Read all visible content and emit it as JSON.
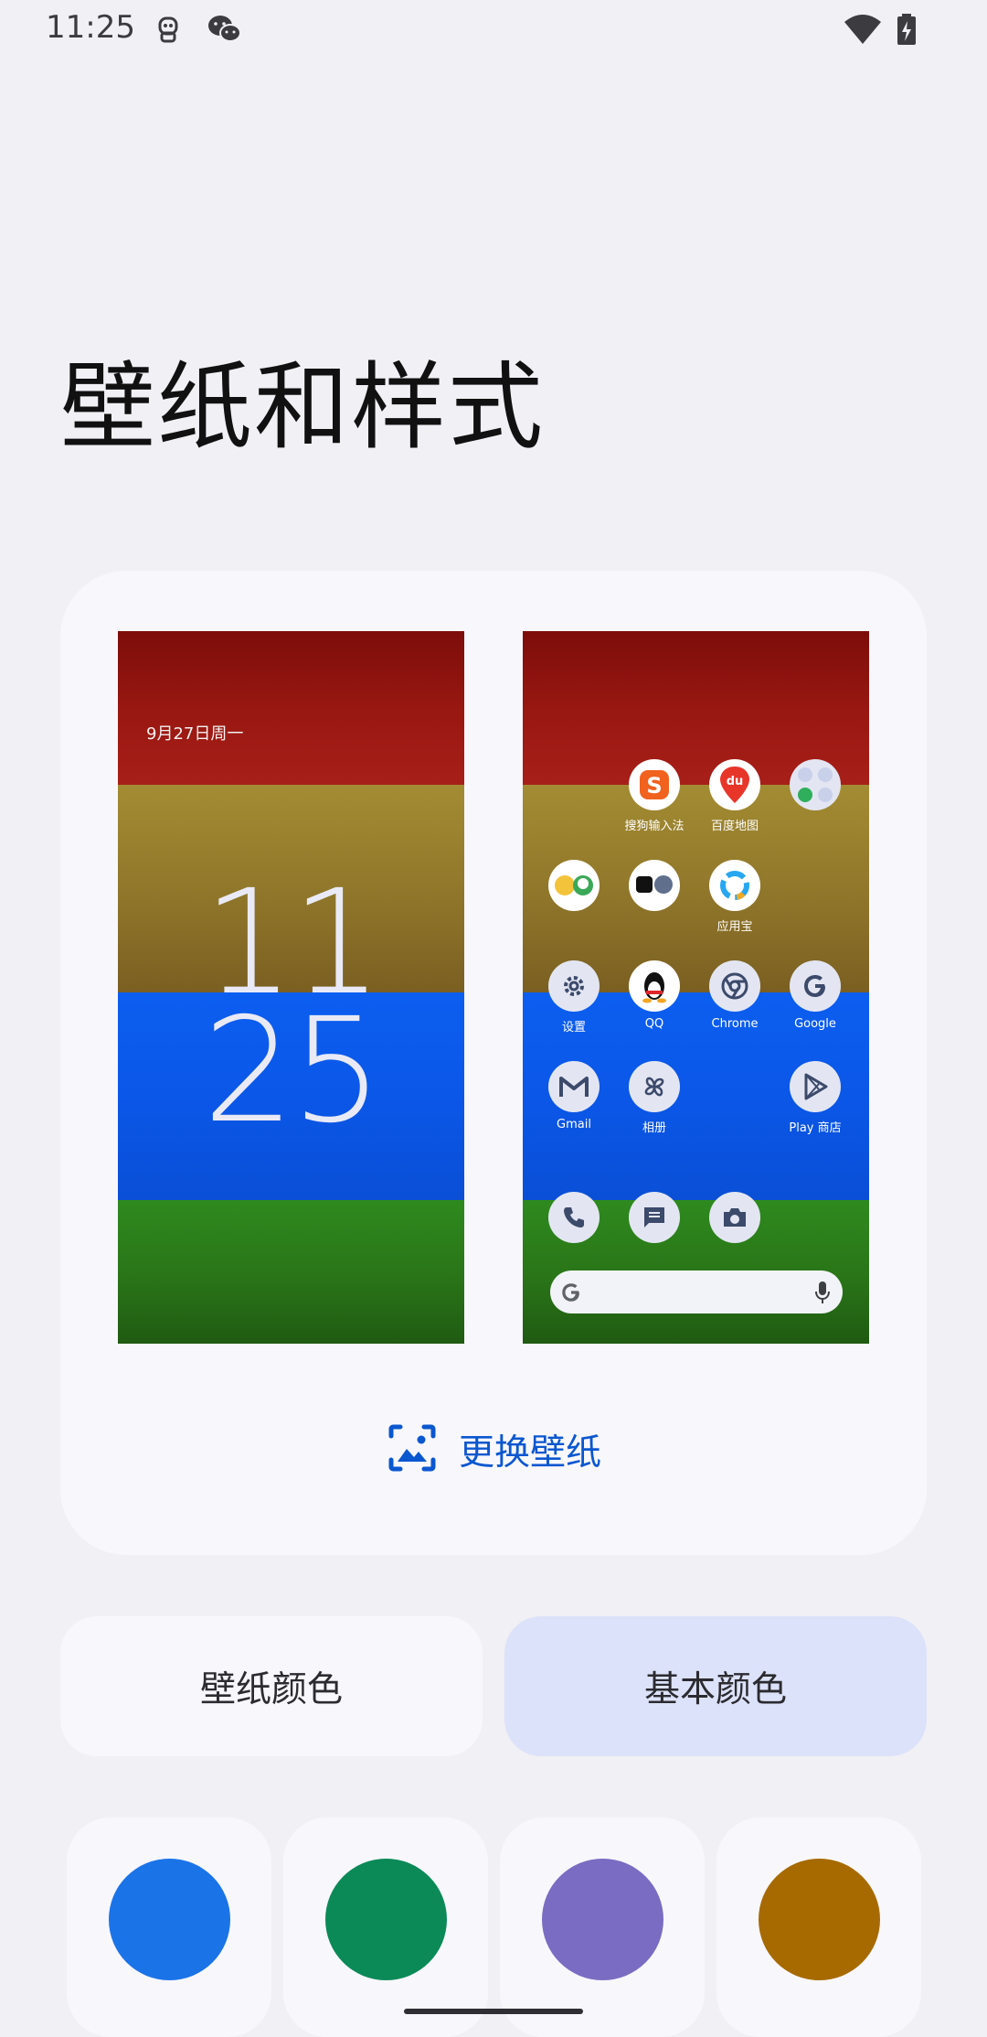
{
  "status_bar": {
    "time": "11:25",
    "icons": [
      "robot-notification-icon",
      "wechat-icon",
      "wifi-icon",
      "battery-charging-icon"
    ]
  },
  "title": "壁纸和样式",
  "preview": {
    "lock_screen": {
      "date": "9月27日周一",
      "hour": "11",
      "minute": "25"
    },
    "home_screen": {
      "apps": [
        {
          "label": "搜狗输入法",
          "icon": "sogou-input-icon"
        },
        {
          "label": "百度地图",
          "icon": "baidu-maps-icon"
        },
        {
          "label": "",
          "icon": "app-folder-icon"
        },
        {
          "label": "",
          "icon": "game-folder-icon"
        },
        {
          "label": "",
          "icon": "media-folder-icon"
        },
        {
          "label": "应用宝",
          "icon": "yingyongbao-icon"
        },
        {
          "label": "设置",
          "icon": "settings-gear-icon"
        },
        {
          "label": "QQ",
          "icon": "qq-penguin-icon"
        },
        {
          "label": "Chrome",
          "icon": "chrome-icon"
        },
        {
          "label": "Google",
          "icon": "google-g-icon"
        },
        {
          "label": "Gmail",
          "icon": "gmail-icon"
        },
        {
          "label": "相册",
          "icon": "photos-pinwheel-icon"
        },
        {
          "label": "Play 商店",
          "icon": "play-store-icon"
        }
      ],
      "dock": [
        "phone-icon",
        "messages-icon",
        "camera-icon"
      ],
      "search_bar": {
        "left_icon": "google-g-icon",
        "right_icon": "mic-icon"
      }
    }
  },
  "change_wallpaper": {
    "label": "更换壁纸",
    "icon": "change-wallpaper-icon"
  },
  "tabs": [
    {
      "label": "壁纸颜色",
      "selected": false
    },
    {
      "label": "基本颜色",
      "selected": true
    }
  ],
  "color_swatches": [
    "#1b73e8",
    "#0b8a58",
    "#7a6cc2",
    "#a76a00"
  ],
  "colors": {
    "accent": "#0b57d0",
    "selected_tab_bg": "#dce2f9",
    "card_bg": "#f8f7fc",
    "page_bg": "#f1f0f5"
  }
}
